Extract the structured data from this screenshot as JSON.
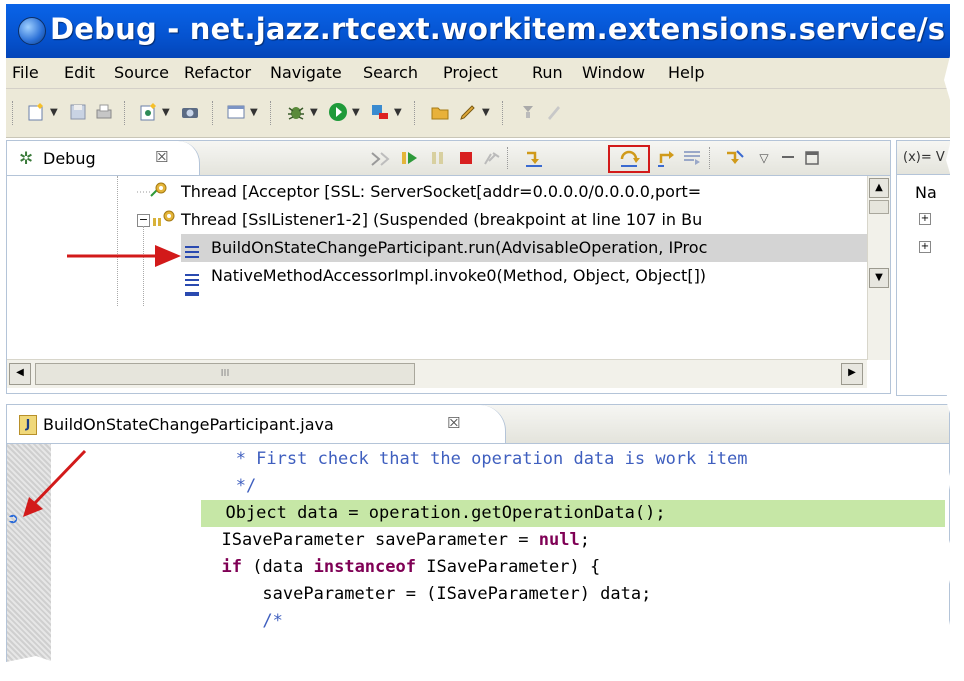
{
  "window": {
    "title": "Debug - net.jazz.rtcext.workitem.extensions.service/s"
  },
  "menu": [
    "File",
    "Edit",
    "Source",
    "Refactor",
    "Navigate",
    "Search",
    "Project",
    "Run",
    "Window",
    "Help"
  ],
  "debug_view": {
    "tab_label": "Debug",
    "tab_close": "☒",
    "rows": [
      "Thread [Acceptor [SSL: ServerSocket[addr=0.0.0.0/0.0.0.0,port=",
      "Thread [SslListener1-2] (Suspended (breakpoint at line 107 in Bu",
      "BuildOnStateChangeParticipant.run(AdvisableOperation, IProc",
      "NativeMethodAccessorImpl.invoke0(Method, Object, Object[])"
    ],
    "hscroll_thumb": "III"
  },
  "variables_view": {
    "tab_label": "(x)= V",
    "column": "Na"
  },
  "editor": {
    "tab_label": "BuildOnStateChangeParticipant.java",
    "tab_close": "☒",
    "lines": [
      "   * First check that the operation data is work item",
      "   */",
      "  Object data = operation.getOperationData();",
      "  ISaveParameter saveParameter = ",
      "null",
      ";",
      "  ",
      "if",
      " (data ",
      "instanceof",
      " ISaveParameter) {",
      "      saveParameter = (ISaveParameter) data;",
      "      /*"
    ]
  },
  "colors": {
    "title_bar": "#0553d0",
    "highlight_box": "#d21a1a",
    "current_line": "#c6e7a6",
    "selected_row": "#d4d4d4",
    "arrow": "#d21a1a"
  }
}
